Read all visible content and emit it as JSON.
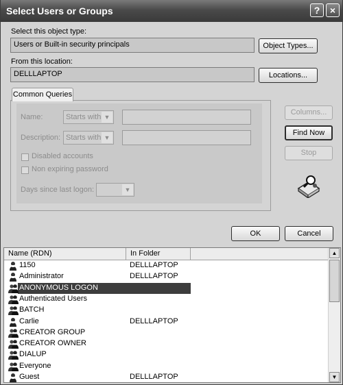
{
  "window": {
    "title": "Select Users or Groups",
    "help_glyph": "?",
    "close_glyph": "×"
  },
  "object_type": {
    "label": "Select this object type:",
    "value": "Users or Built-in security principals",
    "button": "Object Types..."
  },
  "location": {
    "label": "From this location:",
    "value": "DELLLAPTOP",
    "button": "Locations..."
  },
  "queries": {
    "tab": "Common Queries",
    "name_label": "Name:",
    "name_mode": "Starts with",
    "description_label": "Description:",
    "description_mode": "Starts with",
    "disabled_accounts": "Disabled accounts",
    "non_expiring": "Non expiring password",
    "days_label": "Days since last logon:"
  },
  "side_buttons": {
    "columns": "Columns...",
    "find_now": "Find Now",
    "stop": "Stop"
  },
  "footer": {
    "ok": "OK",
    "cancel": "Cancel"
  },
  "results": {
    "columns": [
      "Name (RDN)",
      "In Folder"
    ],
    "rows": [
      {
        "name": "1150",
        "folder": "DELLLAPTOP",
        "icon": "user-icon"
      },
      {
        "name": "Administrator",
        "folder": "DELLLAPTOP",
        "icon": "user-icon"
      },
      {
        "name": "ANONYMOUS LOGON",
        "folder": "",
        "icon": "group-icon",
        "selected": true
      },
      {
        "name": "Authenticated Users",
        "folder": "",
        "icon": "group-icon"
      },
      {
        "name": "BATCH",
        "folder": "",
        "icon": "group-icon"
      },
      {
        "name": "Carlie",
        "folder": "DELLLAPTOP",
        "icon": "user-icon"
      },
      {
        "name": "CREATOR GROUP",
        "folder": "",
        "icon": "group-icon"
      },
      {
        "name": "CREATOR OWNER",
        "folder": "",
        "icon": "group-icon"
      },
      {
        "name": "DIALUP",
        "folder": "",
        "icon": "group-icon"
      },
      {
        "name": "Everyone",
        "folder": "",
        "icon": "group-icon"
      },
      {
        "name": "Guest",
        "folder": "DELLLAPTOP",
        "icon": "user-icon"
      }
    ]
  }
}
